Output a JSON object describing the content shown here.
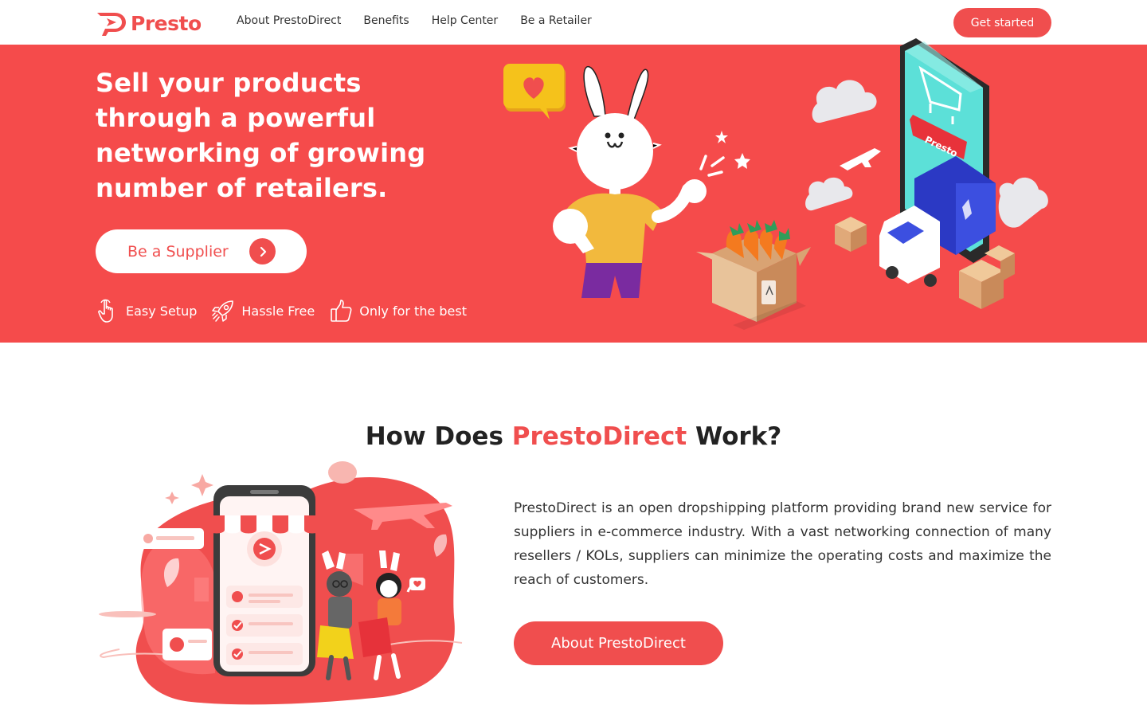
{
  "brand": {
    "name": "Presto",
    "accent": "#f04e4e",
    "hero_bg": "#f54b4b"
  },
  "nav": {
    "links": [
      "About PrestoDirect",
      "Benefits",
      "Help Center",
      "Be a Retailer"
    ],
    "cta": "Get started"
  },
  "hero": {
    "title": "Sell your products through a powerful networking of growing number of retailers.",
    "cta": "Be a Supplier",
    "features": [
      {
        "icon": "hand-pointer-icon",
        "label": "Easy Setup"
      },
      {
        "icon": "rocket-icon",
        "label": "Hassle Free"
      },
      {
        "icon": "thumbs-up-icon",
        "label": "Only for the best"
      }
    ],
    "phone_badge": "Presto"
  },
  "how": {
    "title_pre": "How Does ",
    "title_accent": "PrestoDirect",
    "title_post": " Work?",
    "description": "PrestoDirect is an open dropshipping platform providing brand new service for suppliers in e-commerce industry. With a vast networking connection of many resellers / KOLs, suppliers can minimize the operating costs and maximize the reach of customers.",
    "cta": "About PrestoDirect"
  }
}
